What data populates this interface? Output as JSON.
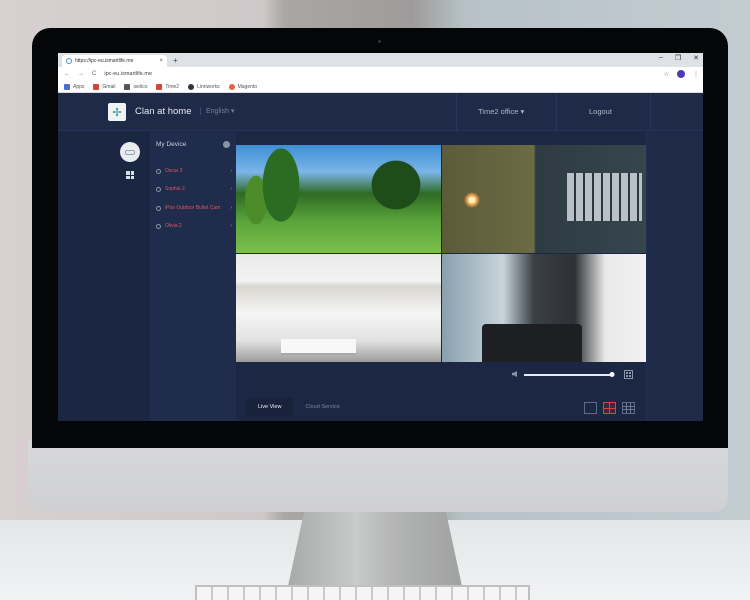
{
  "browser": {
    "tab_title": "https://ipc-eu.ismartlife.me",
    "tab_close": "×",
    "new_tab": "+",
    "window_controls": {
      "minimize": "–",
      "restore": "❐",
      "close": "✕"
    },
    "nav": {
      "back": "←",
      "forward": "→",
      "reload": "C"
    },
    "url": "ipc-eu.ismartlife.me",
    "star": "☆",
    "menu": "⋮",
    "bookmarks": [
      {
        "label": "Apps",
        "icon": "apps-grid-icon",
        "color": "#4a6fd4"
      },
      {
        "label": "Gmail",
        "icon": "gmail-icon",
        "color": "#d44638"
      },
      {
        "label": "iselico",
        "icon": "iselico-icon",
        "color": "#555555"
      },
      {
        "label": "Time2",
        "icon": "time2-icon",
        "color": "#d44638"
      },
      {
        "label": "Linnworks",
        "icon": "linnworks-icon",
        "color": "#333333"
      },
      {
        "label": "Magento",
        "icon": "magento-icon",
        "color": "#e8623a"
      }
    ]
  },
  "app": {
    "logo_icon": "✢",
    "brand": "Clan at home",
    "language": "English ▾",
    "office": "Time2 office ▾",
    "logout": "Logout",
    "device_panel": {
      "title": "My Device",
      "devices": [
        {
          "label": "Oscar 2",
          "caret": "›"
        },
        {
          "label": "Sophia 2",
          "caret": "›"
        },
        {
          "label": "iPoo Outdoor Bullet Cam",
          "caret": "›"
        },
        {
          "label": "Olivia 2",
          "caret": "›"
        }
      ]
    },
    "feeds": [
      {
        "name": "garden"
      },
      {
        "name": "exterior"
      },
      {
        "name": "kitchen"
      },
      {
        "name": "living-room"
      }
    ],
    "volume": {
      "level_percent": 100
    },
    "tabs": [
      {
        "label": "Live View",
        "active": true
      },
      {
        "label": "Cloud Service",
        "active": false
      }
    ],
    "layouts": [
      {
        "name": "single",
        "active": false
      },
      {
        "name": "quad",
        "active": true
      },
      {
        "name": "nine",
        "active": false
      }
    ],
    "colors": {
      "background": "#1c2843",
      "accent_red": "#d4473f",
      "device_label": "#e0565b"
    }
  }
}
